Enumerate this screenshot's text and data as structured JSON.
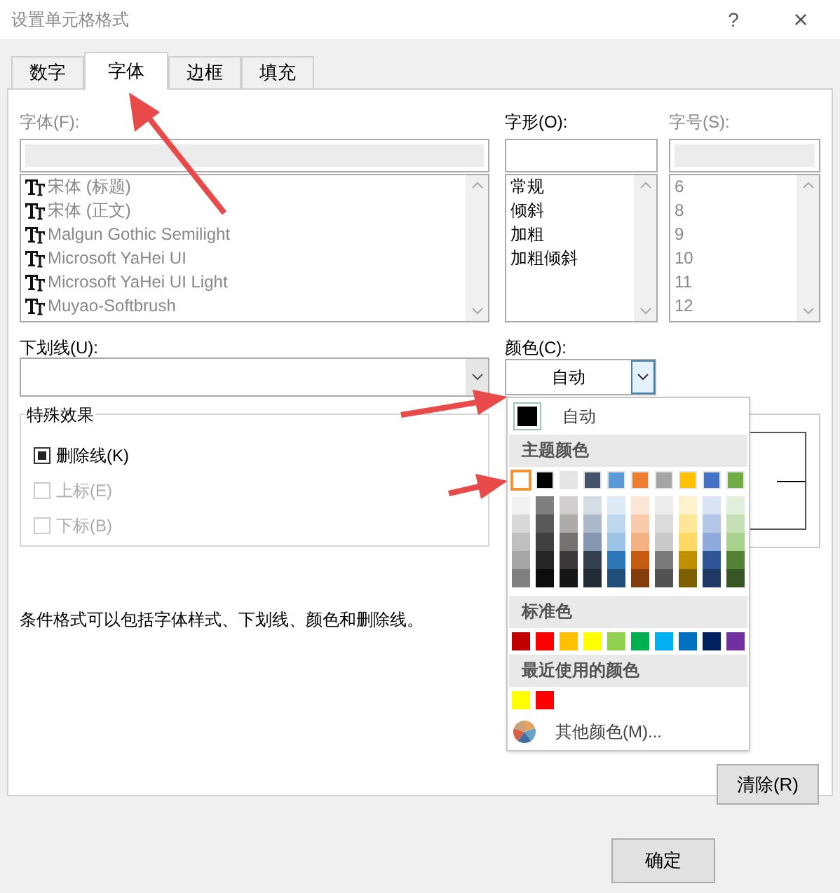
{
  "window": {
    "title": "设置单元格格式",
    "help": "?",
    "close": "×"
  },
  "tabs": [
    {
      "label": "数字",
      "selected": false
    },
    {
      "label": "字体",
      "selected": true
    },
    {
      "label": "边框",
      "selected": false
    },
    {
      "label": "填充",
      "selected": false
    }
  ],
  "font": {
    "label": "字体(F):",
    "items": [
      "宋体 (标题)",
      "宋体 (正文)",
      "Malgun Gothic Semilight",
      "Microsoft YaHei UI",
      "Microsoft YaHei UI Light",
      "Muyao-Softbrush"
    ]
  },
  "style": {
    "label": "字形(O):",
    "items": [
      "常规",
      "倾斜",
      "加粗",
      "加粗倾斜"
    ]
  },
  "size": {
    "label": "字号(S):",
    "items": [
      "6",
      "8",
      "9",
      "10",
      "11",
      "12"
    ]
  },
  "underline": {
    "label": "下划线(U):"
  },
  "color": {
    "label": "颜色(C):",
    "value": "自动"
  },
  "effects": {
    "title": "特殊效果",
    "items": [
      {
        "label": "删除线(K)",
        "checked": true,
        "disabled": false
      },
      {
        "label": "上标(E)",
        "checked": false,
        "disabled": true
      },
      {
        "label": "下标(B)",
        "checked": false,
        "disabled": true
      }
    ]
  },
  "note": "条件格式可以包括字体样式、下划线、颜色和删除线。",
  "color_menu": {
    "auto": {
      "label": "自动",
      "color": "#000000"
    },
    "theme_title": "主题颜色",
    "theme": [
      {
        "color": "#ffffff",
        "selected": true,
        "shades": [
          {
            "color": "#f2f2f2"
          },
          {
            "color": "#d9d9d9"
          },
          {
            "color": "#bfbfbf"
          },
          {
            "color": "#a6a6a6"
          },
          {
            "color": "#808080"
          }
        ]
      },
      {
        "color": "#000000",
        "selected": false,
        "shades": [
          {
            "color": "#7f7f7f"
          },
          {
            "color": "#595959"
          },
          {
            "color": "#404040"
          },
          {
            "color": "#262626"
          },
          {
            "color": "#0d0d0d"
          }
        ]
      },
      {
        "color": "#e7e6e6",
        "selected": false,
        "shades": [
          {
            "color": "#d0cece"
          },
          {
            "color": "#aeabab"
          },
          {
            "color": "#757171"
          },
          {
            "color": "#3a3838"
          },
          {
            "color": "#171616"
          }
        ]
      },
      {
        "color": "#44546a",
        "selected": false,
        "shades": [
          {
            "color": "#d6dce4"
          },
          {
            "color": "#adb9ca"
          },
          {
            "color": "#8496b0"
          },
          {
            "color": "#333f4f"
          },
          {
            "color": "#222a35"
          }
        ]
      },
      {
        "color": "#5b9bd5",
        "selected": false,
        "shades": [
          {
            "color": "#deebf6"
          },
          {
            "color": "#bdd7ee"
          },
          {
            "color": "#9dc3e6"
          },
          {
            "color": "#2e75b5"
          },
          {
            "color": "#1f4e79"
          }
        ]
      },
      {
        "color": "#ed7d31",
        "selected": false,
        "shades": [
          {
            "color": "#fbe5d5"
          },
          {
            "color": "#f8cbad"
          },
          {
            "color": "#f4b183"
          },
          {
            "color": "#c55a11"
          },
          {
            "color": "#833c0b"
          }
        ]
      },
      {
        "color": "#a5a5a5",
        "selected": false,
        "shades": [
          {
            "color": "#ededed"
          },
          {
            "color": "#dbdbdb"
          },
          {
            "color": "#c9c9c9"
          },
          {
            "color": "#7b7b7b"
          },
          {
            "color": "#525252"
          }
        ]
      },
      {
        "color": "#ffc000",
        "selected": false,
        "shades": [
          {
            "color": "#fff2cc"
          },
          {
            "color": "#ffe699"
          },
          {
            "color": "#ffd966"
          },
          {
            "color": "#bf9000"
          },
          {
            "color": "#7f6000"
          }
        ]
      },
      {
        "color": "#4472c4",
        "selected": false,
        "shades": [
          {
            "color": "#dae3f3"
          },
          {
            "color": "#b4c7e7"
          },
          {
            "color": "#8faadc"
          },
          {
            "color": "#2f5597"
          },
          {
            "color": "#203864"
          }
        ]
      },
      {
        "color": "#70ad47",
        "selected": false,
        "shades": [
          {
            "color": "#e2efda"
          },
          {
            "color": "#c5e0b4"
          },
          {
            "color": "#a9d18e"
          },
          {
            "color": "#538135"
          },
          {
            "color": "#375623"
          }
        ]
      }
    ],
    "standard_title": "标准色",
    "standard": [
      {
        "color": "#c00000"
      },
      {
        "color": "#ff0000"
      },
      {
        "color": "#ffc000"
      },
      {
        "color": "#ffff00"
      },
      {
        "color": "#92d050"
      },
      {
        "color": "#00b050"
      },
      {
        "color": "#00b0f0"
      },
      {
        "color": "#0070c0"
      },
      {
        "color": "#002060"
      },
      {
        "color": "#7030a0"
      }
    ],
    "recent_title": "最近使用的颜色",
    "recent": [
      {
        "color": "#ffff00"
      },
      {
        "color": "#ff0000"
      }
    ],
    "more": "其他颜色(M)..."
  },
  "buttons": {
    "clear": "清除(R)",
    "ok": "确定"
  }
}
